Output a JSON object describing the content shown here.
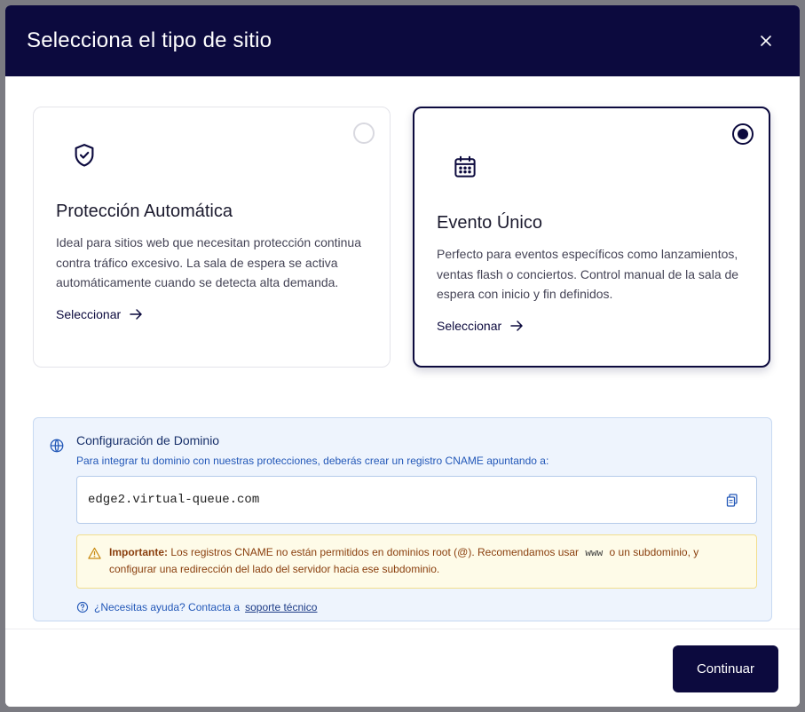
{
  "modal": {
    "title": "Selecciona el tipo de sitio"
  },
  "cards": [
    {
      "icon": "shield-check-icon",
      "title": "Protección Automática",
      "description": "Ideal para sitios web que necesitan protección continua contra tráfico excesivo. La sala de espera se activa automáticamente cuando se detecta alta demanda.",
      "link_label": "Seleccionar",
      "selected": false
    },
    {
      "icon": "calendar-icon",
      "title": "Evento Único",
      "description": "Perfecto para eventos específicos como lanzamientos, ventas flash o conciertos. Control manual de la sala de espera con inicio y fin definidos.",
      "link_label": "Seleccionar",
      "selected": true
    }
  ],
  "domain": {
    "title": "Configuración de Dominio",
    "subtitle": "Para integrar tu dominio con nuestras protecciones, deberás crear un registro CNAME apuntando a:",
    "cname": "edge2.virtual-queue.com",
    "warning_label": "Importante:",
    "warning_text_1": "Los registros CNAME no están permitidos en dominios root (@). Recomendamos usar",
    "warning_code": "www",
    "warning_text_2": "o un subdominio, y configurar una redirección del lado del servidor hacia ese subdominio.",
    "help_text": "¿Necesitas ayuda? Contacta a",
    "help_link": "soporte técnico"
  },
  "footer": {
    "continue_label": "Continuar"
  },
  "colors": {
    "primary": "#0c0a3e",
    "info_bg": "#eef4fd",
    "warning_bg": "#fefbe8",
    "link_blue": "#2358b8"
  }
}
